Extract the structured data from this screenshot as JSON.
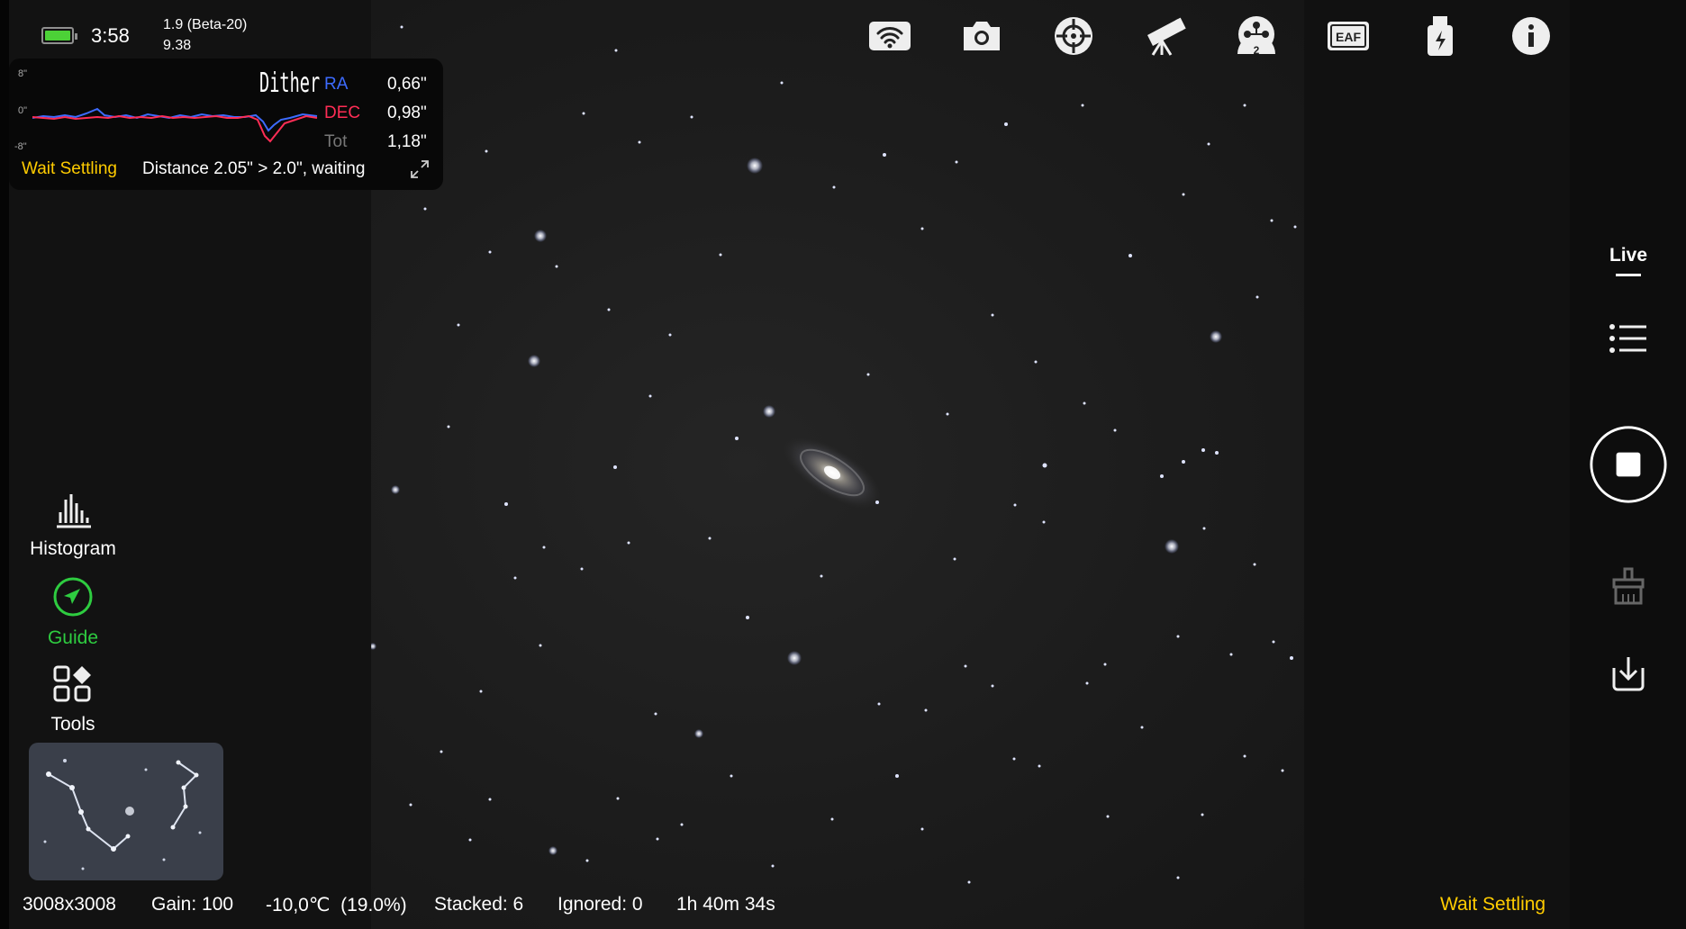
{
  "status_bar": {
    "time": "3:58",
    "version": "1.9 (Beta-20)",
    "build": "9.38"
  },
  "guide_panel": {
    "mode": "Dither",
    "y_labels": [
      "8\"",
      "0\"",
      "-8\""
    ],
    "ra_label": "RA",
    "ra_value": "0,66\"",
    "dec_label": "DEC",
    "dec_value": "0,98\"",
    "tot_label": "Tot",
    "tot_value": "1,18\"",
    "state": "Wait Settling",
    "message": "Distance 2.05\" > 2.0\", waiting",
    "colors": {
      "ra": "#3d6bff",
      "dec": "#ff2d55",
      "state": "#ffcc00"
    }
  },
  "top_toolbar": {
    "icons": [
      "wifi-icon",
      "camera-icon",
      "guide-scope-icon",
      "telescope-icon",
      "filter-wheel-icon",
      "eaf-icon",
      "usb-power-icon",
      "info-icon"
    ],
    "filter_wheel_slot": "2",
    "eaf_text": "EAF"
  },
  "left_menu": {
    "histogram": "Histogram",
    "guide": "Guide",
    "tools": "Tools",
    "guide_color": "#2ecc40"
  },
  "right_bar": {
    "live_label": "Live"
  },
  "bottom_bar": {
    "resolution": "3008x3008",
    "gain": "Gain: 100",
    "temperature": "-10,0℃  (19.0%)",
    "stacked": "Stacked: 6",
    "ignored": "Ignored: 0",
    "duration": "1h 40m 34s",
    "state": "Wait Settling"
  }
}
